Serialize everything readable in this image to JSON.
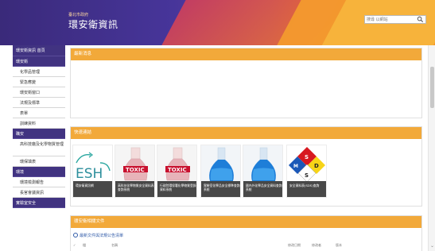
{
  "header": {
    "subtitle": "臺北市政府",
    "title": "環安衛資訊",
    "search_placeholder": "搜尋 以網站"
  },
  "sidebar": {
    "items": [
      {
        "label": "環安衛資訊 首頁",
        "type": "head"
      },
      {
        "label": "環安衛",
        "type": "head"
      },
      {
        "label": "化學品管理",
        "type": "sub"
      },
      {
        "label": "緊急應變",
        "type": "sub"
      },
      {
        "label": "環安衛窗口",
        "type": "sub"
      },
      {
        "label": "法規及標準",
        "type": "sub"
      },
      {
        "label": "表單",
        "type": "sub"
      },
      {
        "label": "訓練資料",
        "type": "sub"
      },
      {
        "label": "職安",
        "type": "head"
      },
      {
        "label": "高科技廠及化學物質管理",
        "type": "sub"
      },
      {
        "label": "環保填表",
        "type": "sub"
      },
      {
        "label": "環境",
        "type": "head"
      },
      {
        "label": "環境檢測報告",
        "type": "sub"
      },
      {
        "label": "長官會議資訊",
        "type": "sub"
      },
      {
        "label": "實驗室安全",
        "type": "head"
      }
    ]
  },
  "panels": {
    "announcements": {
      "title": "最新消息"
    },
    "quick_links": {
      "title": "快速連結"
    },
    "documents": {
      "title": "環安衛相關文件",
      "link": "最新文件與法規公告清單",
      "toolbar": [
        "✓",
        "檔",
        "名稱",
        "修改日期",
        "修改者",
        "版本"
      ]
    }
  },
  "tiles": [
    {
      "caption": "環安衛資訊網",
      "kind": "esh"
    },
    {
      "caption": "高科技化學物質安全資料表查詢系統",
      "kind": "toxic"
    },
    {
      "caption": "行政院環保署化學物質登錄資料系統",
      "kind": "toxic"
    },
    {
      "caption": "實驗室化學品安全標準查詢系統",
      "kind": "flask"
    },
    {
      "caption": "國內外化學品安全資料查詢系統",
      "kind": "flask"
    },
    {
      "caption": "安全資料表(SDS)查詢",
      "kind": "diamond"
    }
  ],
  "colors": {
    "nav_head": "#413381",
    "panel_head": "#f2a93a"
  }
}
